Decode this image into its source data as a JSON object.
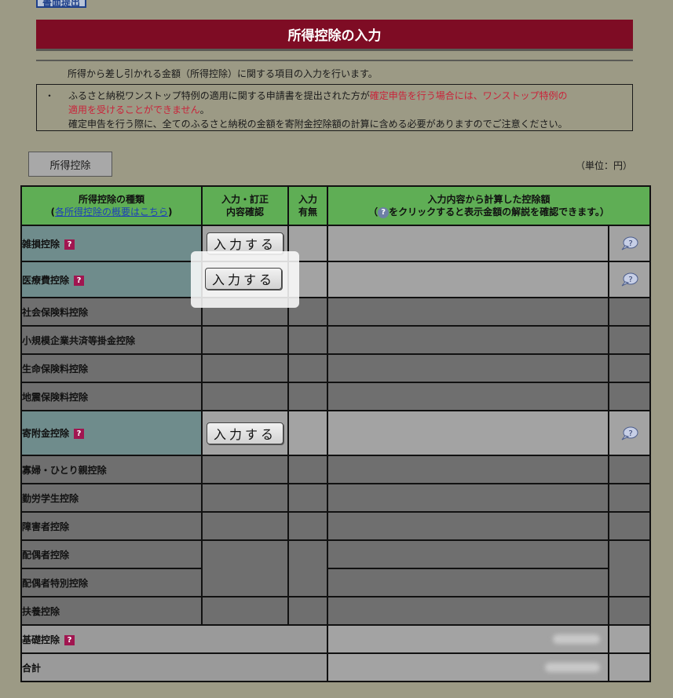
{
  "header": {
    "top_button": "書面提出",
    "title": "所得控除の入力",
    "description": "所得から差し引かれる金額（所得控除）に関する項目の入力を行います。"
  },
  "notice": {
    "bullet": "・",
    "line1_normal": "ふるさと納税ワンストップ特例の適用に関する申請書を提出された方が",
    "line1_red": "確定申告を行う場合には、ワンストップ特例の",
    "line2_red": "適用を受けることができません",
    "line2_normal": "。",
    "line3": "確定申告を行う際に、全てのふるさと納税の金額を寄附金控除額の計算に含める必要がありますのでご注意ください。"
  },
  "section": {
    "tab_label": "所得控除",
    "unit": "（単位：円）"
  },
  "table": {
    "headers": {
      "type_title": "所得控除の種類",
      "type_link": "各所得控除の概要はこちら",
      "input_line1": "入力・訂正",
      "input_line2": "内容確認",
      "status_line1": "入力",
      "status_line2": "有無",
      "amount_line1": "入力内容から計算した控除額",
      "amount_line2_pre": "（",
      "amount_line2_post": "をクリックすると表示金額の解説を確認できます。）"
    },
    "button_label": "入力する",
    "help_glyph": "?",
    "rows": [
      {
        "name": "雑損控除"
      },
      {
        "name": "医療費控除"
      },
      {
        "name": "社会保険料控除"
      },
      {
        "name": "小規模企業共済等掛金控除"
      },
      {
        "name": "生命保険料控除"
      },
      {
        "name": "地震保険料控除"
      },
      {
        "name": "寄附金控除"
      },
      {
        "name": "寡婦・ひとり親控除"
      },
      {
        "name": "勤労学生控除"
      },
      {
        "name": "障害者控除"
      },
      {
        "name": "配偶者控除"
      },
      {
        "name": "配偶者特別控除"
      },
      {
        "name": "扶養控除"
      },
      {
        "name": "基礎控除"
      },
      {
        "name": "合計"
      }
    ]
  },
  "colors": {
    "title_bg": "#7e0c24",
    "header_green": "#5fae55",
    "help_icon": "#a11550",
    "red_text": "#c9243a"
  }
}
